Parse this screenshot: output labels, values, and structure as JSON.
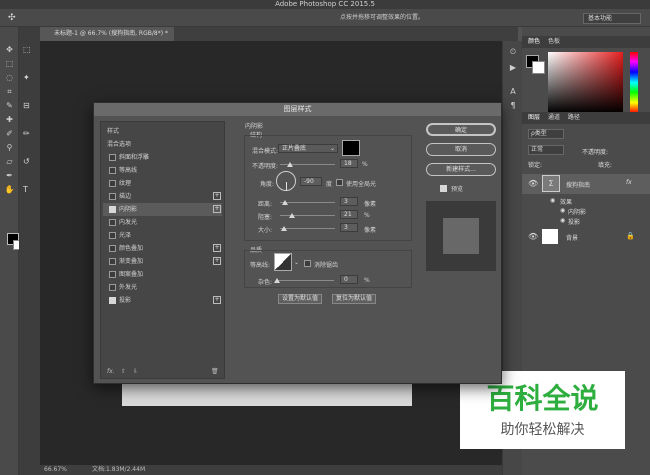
{
  "app": {
    "title": "Adobe Photoshop CC 2015.5"
  },
  "options_bar": {
    "hint": "点按并拖移可调整效果的位置。",
    "workspace": "基本功能"
  },
  "document": {
    "tab_title": "未标题-1 @ 66.7% (搜狗指南, RGB/8*) *",
    "zoom": "66.67%",
    "doc_info": "文档:1.83M/2.44M"
  },
  "right_panel": {
    "color_tabs": [
      "颜色",
      "色板"
    ],
    "layers_tabs": [
      "图层",
      "通道",
      "路径"
    ],
    "kind_label": "ρ类型",
    "blend_mode": "正常",
    "opacity_label": "不透明度:",
    "fill_label": "填充:",
    "lock_label": "锁定:",
    "layers": [
      {
        "name": "搜狗指南",
        "fx": "fx"
      },
      {
        "name": "效果"
      },
      {
        "name": "内阴影"
      },
      {
        "name": "投影"
      },
      {
        "name": "背景"
      }
    ]
  },
  "dialog": {
    "title": "图层样式",
    "style_list": [
      {
        "label": "样式",
        "checkbox": false
      },
      {
        "label": "混合选项",
        "checkbox": false
      },
      {
        "label": "斜面和浮雕",
        "checkbox": true,
        "checked": false
      },
      {
        "label": "等高线",
        "checkbox": true,
        "checked": false
      },
      {
        "label": "纹理",
        "checkbox": true,
        "checked": false
      },
      {
        "label": "描边",
        "checkbox": true,
        "checked": false,
        "plus": "+"
      },
      {
        "label": "内阴影",
        "checkbox": true,
        "checked": true,
        "plus": "+",
        "selected": true
      },
      {
        "label": "内发光",
        "checkbox": true,
        "checked": false
      },
      {
        "label": "光泽",
        "checkbox": true,
        "checked": false
      },
      {
        "label": "颜色叠加",
        "checkbox": true,
        "checked": false,
        "plus": "+"
      },
      {
        "label": "渐变叠加",
        "checkbox": true,
        "checked": false,
        "plus": "+"
      },
      {
        "label": "图案叠加",
        "checkbox": true,
        "checked": false
      },
      {
        "label": "外发光",
        "checkbox": true,
        "checked": false
      },
      {
        "label": "投影",
        "checkbox": true,
        "checked": true,
        "plus": "+"
      }
    ],
    "fx_bar": "fx. ⇧ ⇩",
    "inner_shadow": {
      "section_title": "内阴影",
      "structure_title": "结构",
      "blend_mode_label": "混合模式:",
      "blend_mode_value": "正片叠底",
      "shadow_color": "#000000",
      "opacity_label": "不透明度:",
      "opacity_value": "18",
      "opacity_unit": "%",
      "opacity_level": 0.18,
      "angle_label": "角度:",
      "angle_value": "-90",
      "angle_unit": "度",
      "global_light_label": "使用全局光",
      "distance_label": "距离:",
      "distance_value": "3",
      "distance_unit": "像素",
      "choke_label": "阻塞:",
      "choke_value": "21",
      "choke_unit": "%",
      "size_label": "大小:",
      "size_value": "3",
      "size_unit": "像素",
      "quality_title": "品质",
      "contour_label": "等高线:",
      "antialias_label": "消除锯齿",
      "noise_label": "杂色:",
      "noise_value": "0",
      "noise_unit": "%",
      "set_default": "设置为默认值",
      "reset_default": "复位为默认值"
    },
    "buttons": {
      "ok": "确定",
      "cancel": "取消",
      "new_style": "新建样式...",
      "preview": "预览"
    }
  },
  "watermark": {
    "big": "百科全说",
    "small": "助你轻松解决"
  }
}
